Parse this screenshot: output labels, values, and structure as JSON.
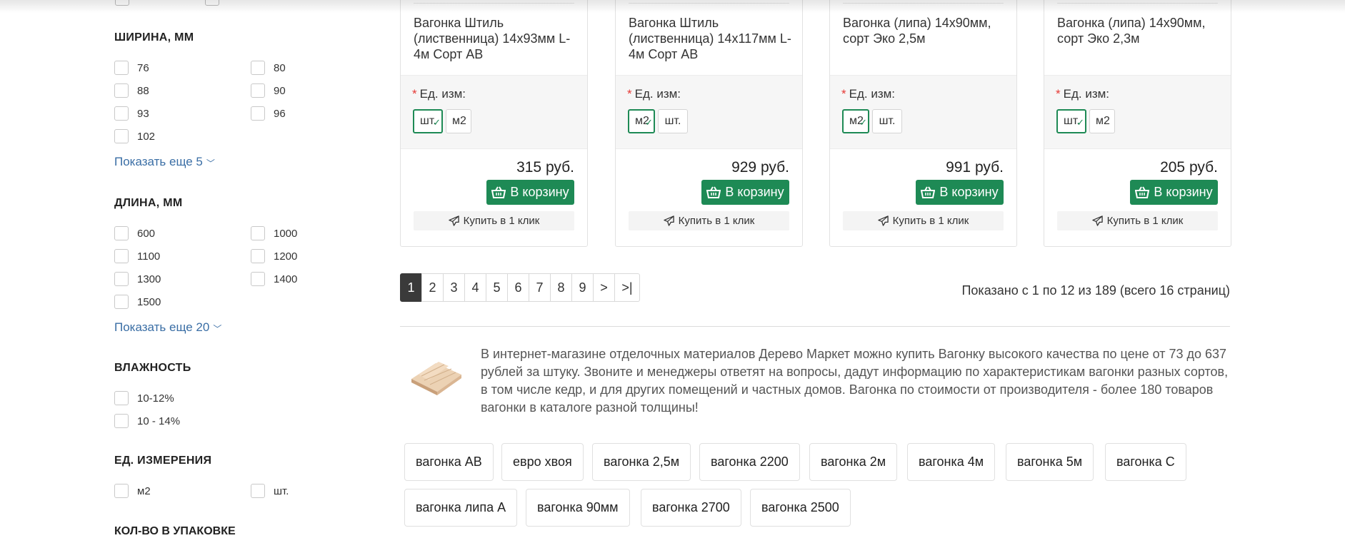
{
  "sidebar": {
    "filters": [
      {
        "title": "ШИРИНА, ММ",
        "options": [
          "76",
          "80",
          "88",
          "90",
          "93",
          "96",
          "102"
        ],
        "show_more": "Показать еще 5"
      },
      {
        "title": "ДЛИНА, ММ",
        "options": [
          "600",
          "1000",
          "1100",
          "1200",
          "1300",
          "1400",
          "1500"
        ],
        "show_more": "Показать еще 20"
      },
      {
        "title": "ВЛАЖНОСТЬ",
        "options": [
          "10-12%",
          "10 - 14%"
        ]
      },
      {
        "title": "ЕД. ИЗМЕРЕНИЯ",
        "options": [
          "м2",
          "шт."
        ]
      }
    ],
    "next_title_cut": "КОЛ-ВО В УПАКОВКЕ"
  },
  "products": [
    {
      "name": "Вагонка Штиль (лиственница) 14х93мм L-4м Сорт АВ",
      "unit_label": "Ед. изм:",
      "units": [
        {
          "label": "шт.",
          "selected": true
        },
        {
          "label": "м2",
          "selected": false
        }
      ],
      "price": "315 руб.",
      "cart_label": "В корзину",
      "oneclick_label": "Купить в 1 клик"
    },
    {
      "name": "Вагонка Штиль (лиственница) 14х117мм L-4м Сорт АВ",
      "unit_label": "Ед. изм:",
      "units": [
        {
          "label": "м2",
          "selected": true
        },
        {
          "label": "шт.",
          "selected": false
        }
      ],
      "price": "929 руб.",
      "cart_label": "В корзину",
      "oneclick_label": "Купить в 1 клик"
    },
    {
      "name": "Вагонка (липа) 14х90мм, сорт Эко 2,5м",
      "unit_label": "Ед. изм:",
      "units": [
        {
          "label": "м2",
          "selected": true
        },
        {
          "label": "шт.",
          "selected": false
        }
      ],
      "price": "991 руб.",
      "cart_label": "В корзину",
      "oneclick_label": "Купить в 1 клик"
    },
    {
      "name": "Вагонка (липа) 14х90мм, сорт Эко 2,3м",
      "unit_label": "Ед. изм:",
      "units": [
        {
          "label": "шт.",
          "selected": true
        },
        {
          "label": "м2",
          "selected": false
        }
      ],
      "price": "205 руб.",
      "cart_label": "В корзину",
      "oneclick_label": "Купить в 1 клик"
    }
  ],
  "pagination": {
    "pages": [
      "1",
      "2",
      "3",
      "4",
      "5",
      "6",
      "7",
      "8",
      "9",
      ">",
      ">|"
    ],
    "active": "1",
    "summary": "Показано с 1 по 12 из 189 (всего 16 страниц)"
  },
  "description": "В интернет-магазине отделочных материалов Дерево Маркет можно купить Вагонку высокого качества по цене от 73 до 637 рублей за штуку. Звоните и менеджеры ответят на вопросы, дадут информацию по характеристикам вагонки разных сортов, в том числе кедр, и для других помещений и частных домов. Вагонка по стоимости от производителя - более 180 товаров вагонки в каталоге разной толщины!",
  "tags": [
    "вагонка АВ",
    "евро хвоя",
    "вагонка 2,5м",
    "вагонка 2200",
    "вагонка 2м",
    "вагонка 4м",
    "вагонка 5м",
    "вагонка С",
    "вагонка липа А",
    "вагонка 90мм",
    "вагонка 2700",
    "вагонка 2500"
  ],
  "colors": {
    "accent_green": "#1e8a55",
    "link_blue": "#3a6ea5",
    "required_red": "#e53935",
    "active_page": "#3a3a3a"
  },
  "icons": {
    "cart": "basket-icon",
    "oneclick": "paper-plane-icon",
    "show_more": "chevron-down-icon",
    "selected": "checkmark-icon"
  }
}
